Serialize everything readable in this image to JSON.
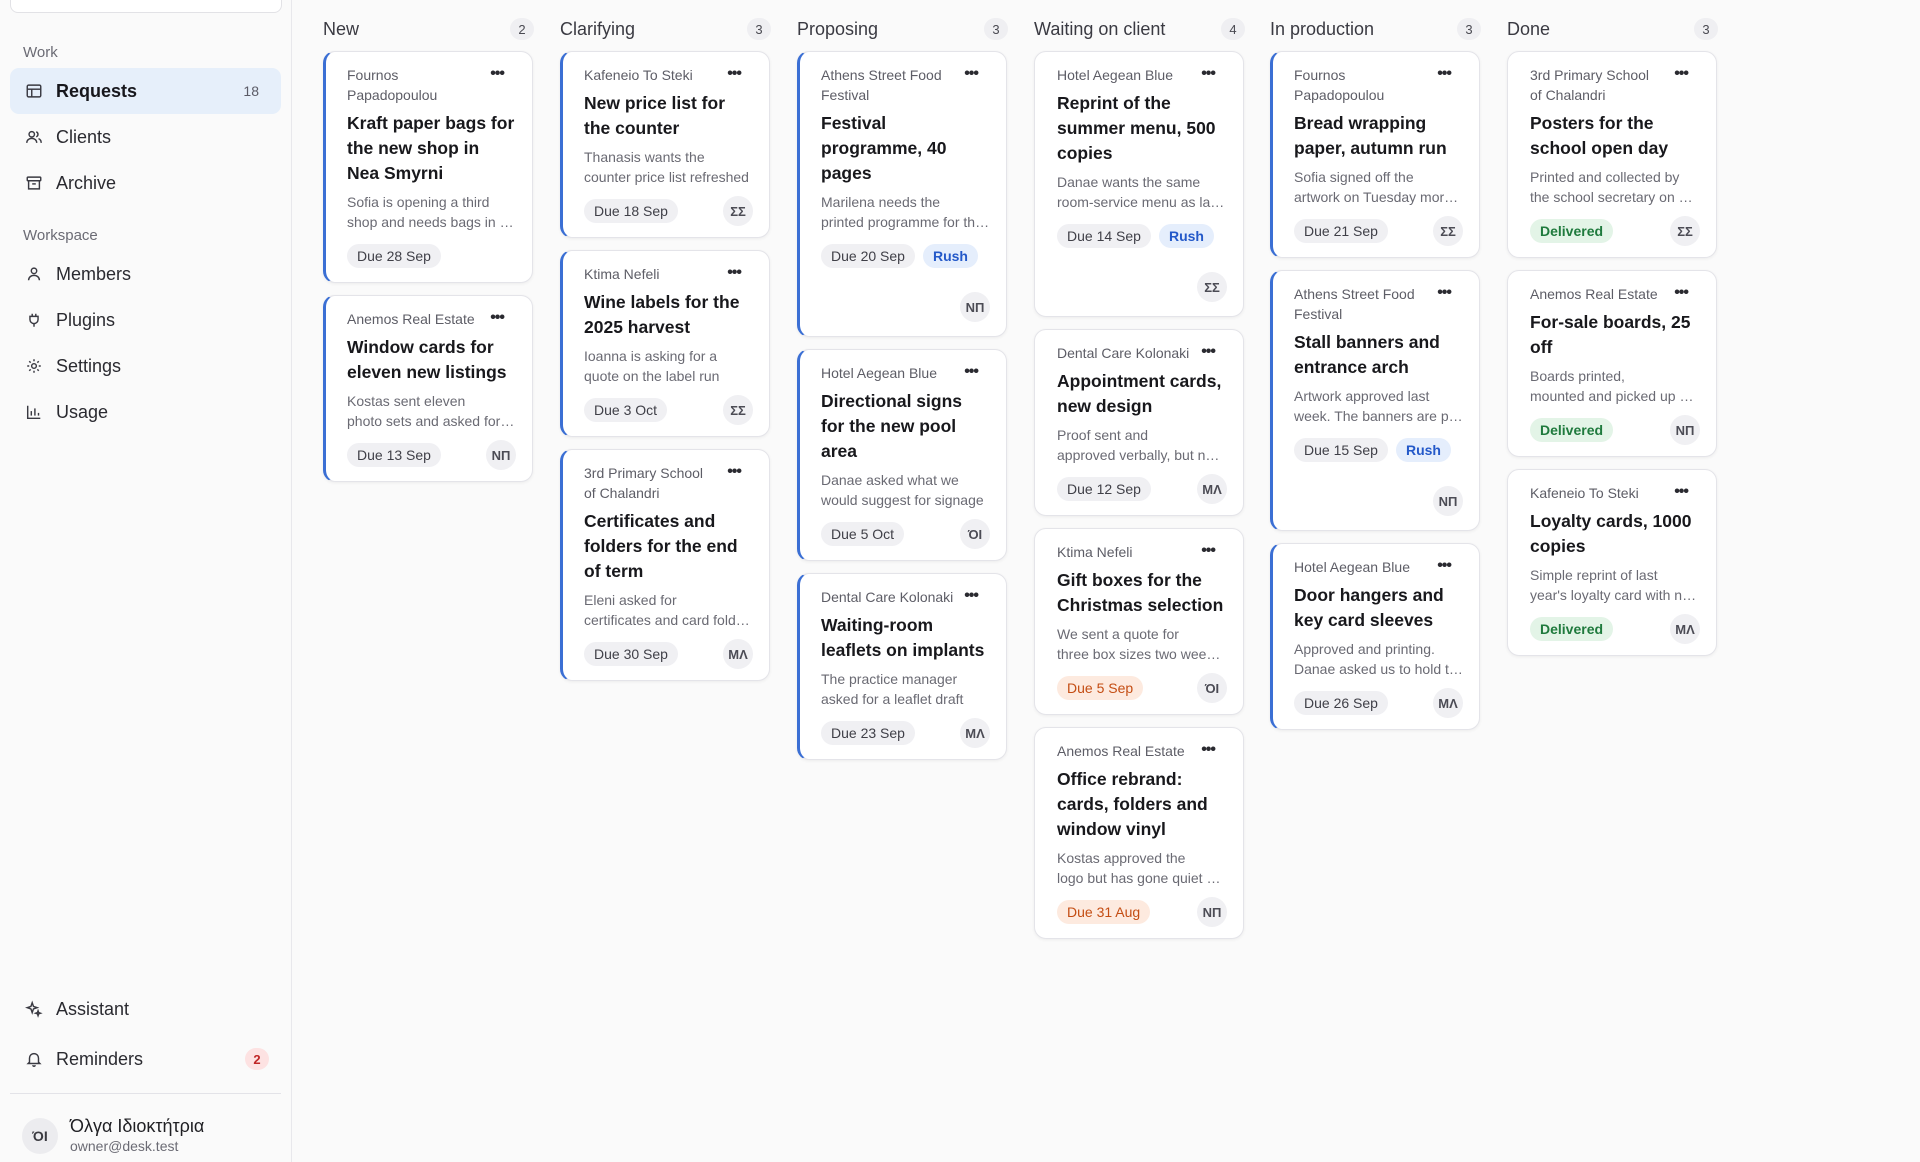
{
  "sidebar": {
    "sections": {
      "work": "Work",
      "workspace": "Workspace"
    },
    "items": [
      {
        "label": "Requests",
        "count": "18"
      },
      {
        "label": "Clients"
      },
      {
        "label": "Archive"
      },
      {
        "label": "Members"
      },
      {
        "label": "Plugins"
      },
      {
        "label": "Settings"
      },
      {
        "label": "Usage"
      },
      {
        "label": "Assistant"
      },
      {
        "label": "Reminders",
        "badge": "2"
      }
    ],
    "user": {
      "initials": "ΌΙ",
      "name": "Όλγα Ιδιοκτήτρια",
      "email": "owner@desk.test"
    }
  },
  "columns": [
    {
      "title": "New",
      "count": "2",
      "cards": [
        {
          "client": "Fournos Papadopoulou",
          "title": "Kraft paper bags for the new shop in Nea Smyrni",
          "desc": [
            "Sofia is opening a third",
            "shop and needs bags in time for the opening"
          ],
          "due": "Due 28 Sep",
          "due_style": "normal",
          "tag": "",
          "avatar": "",
          "accent": true
        },
        {
          "client": "Anemos Real Estate",
          "title": "Window cards for eleven new listings",
          "desc": [
            "Kostas sent eleven",
            "photo sets and asked for window cards"
          ],
          "due": "Due 13 Sep",
          "due_style": "normal",
          "tag": "",
          "avatar": "ΝΠ",
          "accent": true
        }
      ]
    },
    {
      "title": "Clarifying",
      "count": "3",
      "cards": [
        {
          "client": "Kafeneio To Steki",
          "title": "New price list for the counter",
          "desc": [
            "Thanasis wants the",
            "counter price list refreshed"
          ],
          "due": "Due 18 Sep",
          "due_style": "normal",
          "tag": "",
          "avatar": "ΣΣ",
          "accent": true
        },
        {
          "client": "Ktima Nefeli",
          "title": "Wine labels for the 2025 harvest",
          "desc": [
            "Ioanna is asking for a",
            "quote on the label run"
          ],
          "due": "Due 3 Oct",
          "due_style": "normal",
          "tag": "",
          "avatar": "ΣΣ",
          "accent": true
        },
        {
          "client": "3rd Primary School of Chalandri",
          "title": "Certificates and folders for the end of term",
          "desc": [
            "Eleni asked for",
            "certificates and card folders"
          ],
          "due": "Due 30 Sep",
          "due_style": "normal",
          "tag": "",
          "avatar": "ΜΛ",
          "accent": true
        }
      ]
    },
    {
      "title": "Proposing",
      "count": "3",
      "cards": [
        {
          "client": "Athens Street Food Festival",
          "title": "Festival programme, 40 pages",
          "desc": [
            "Marilena needs the",
            "printed programme for the festival"
          ],
          "due": "Due 20 Sep",
          "due_style": "normal",
          "tag": "Rush",
          "avatar": "ΝΠ",
          "accent": true
        },
        {
          "client": "Hotel Aegean Blue",
          "title": "Directional signs for the new pool area",
          "desc": [
            "Danae asked what we",
            "would suggest for signage"
          ],
          "due": "Due 5 Oct",
          "due_style": "normal",
          "tag": "",
          "avatar": "ΌΙ",
          "accent": true
        },
        {
          "client": "Dental Care Kolonaki",
          "title": "Waiting-room leaflets on implants",
          "desc": [
            "The practice manager",
            "asked for a leaflet draft"
          ],
          "due": "Due 23 Sep",
          "due_style": "normal",
          "tag": "",
          "avatar": "ΜΛ",
          "accent": true
        }
      ]
    },
    {
      "title": "Waiting on client",
      "count": "4",
      "cards": [
        {
          "client": "Hotel Aegean Blue",
          "title": "Reprint of the summer menu, 500 copies",
          "desc": [
            "Danae wants the same",
            "room-service menu as last year"
          ],
          "due": "Due 14 Sep",
          "due_style": "normal",
          "tag": "Rush",
          "avatar": "ΣΣ",
          "accent": false
        },
        {
          "client": "Dental Care Kolonaki",
          "title": "Appointment cards, new design",
          "desc": [
            "Proof sent and",
            "approved verbally, but not in writing"
          ],
          "due": "Due 12 Sep",
          "due_style": "normal",
          "tag": "",
          "avatar": "ΜΛ",
          "accent": false
        },
        {
          "client": "Ktima Nefeli",
          "title": "Gift boxes for the Christmas selection",
          "desc": [
            "We sent a quote for",
            "three box sizes two weeks ago"
          ],
          "due": "Due 5 Sep",
          "due_style": "overdue",
          "tag": "",
          "avatar": "ΌΙ",
          "accent": false
        },
        {
          "client": "Anemos Real Estate",
          "title": "Office rebrand: cards, folders and window vinyl",
          "desc": [
            "Kostas approved the",
            "logo but has gone quiet since"
          ],
          "due": "Due 31 Aug",
          "due_style": "overdue",
          "tag": "",
          "avatar": "ΝΠ",
          "accent": false
        }
      ]
    },
    {
      "title": "In production",
      "count": "3",
      "cards": [
        {
          "client": "Fournos Papadopoulou",
          "title": "Bread wrapping paper, autumn run",
          "desc": [
            "Sofia signed off the",
            "artwork on Tuesday morning"
          ],
          "due": "Due 21 Sep",
          "due_style": "normal",
          "tag": "",
          "avatar": "ΣΣ",
          "accent": true
        },
        {
          "client": "Athens Street Food Festival",
          "title": "Stall banners and entrance arch",
          "desc": [
            "Artwork approved last",
            "week. The banners are printing"
          ],
          "due": "Due 15 Sep",
          "due_style": "normal",
          "tag": "Rush",
          "avatar": "ΝΠ",
          "accent": true
        },
        {
          "client": "Hotel Aegean Blue",
          "title": "Door hangers and key card sleeves",
          "desc": [
            "Approved and printing.",
            "Danae asked us to hold the sleeves"
          ],
          "due": "Due 26 Sep",
          "due_style": "normal",
          "tag": "",
          "avatar": "ΜΛ",
          "accent": true
        }
      ]
    },
    {
      "title": "Done",
      "count": "3",
      "cards": [
        {
          "client": "3rd Primary School of Chalandri",
          "title": "Posters for the school open day",
          "desc": [
            "Printed and collected by",
            "the school secretary on Friday"
          ],
          "due": "Delivered",
          "due_style": "done",
          "tag": "",
          "avatar": "ΣΣ",
          "accent": false
        },
        {
          "client": "Anemos Real Estate",
          "title": "For-sale boards, 25 off",
          "desc": [
            "Boards printed,",
            "mounted and picked up by Kostas"
          ],
          "due": "Delivered",
          "due_style": "done",
          "tag": "",
          "avatar": "ΝΠ",
          "accent": false
        },
        {
          "client": "Kafeneio To Steki",
          "title": "Loyalty cards, 1000 copies",
          "desc": [
            "Simple reprint of last",
            "year's loyalty card with new stamps"
          ],
          "due": "Delivered",
          "due_style": "done",
          "tag": "",
          "avatar": "ΜΛ",
          "accent": false
        }
      ]
    }
  ]
}
